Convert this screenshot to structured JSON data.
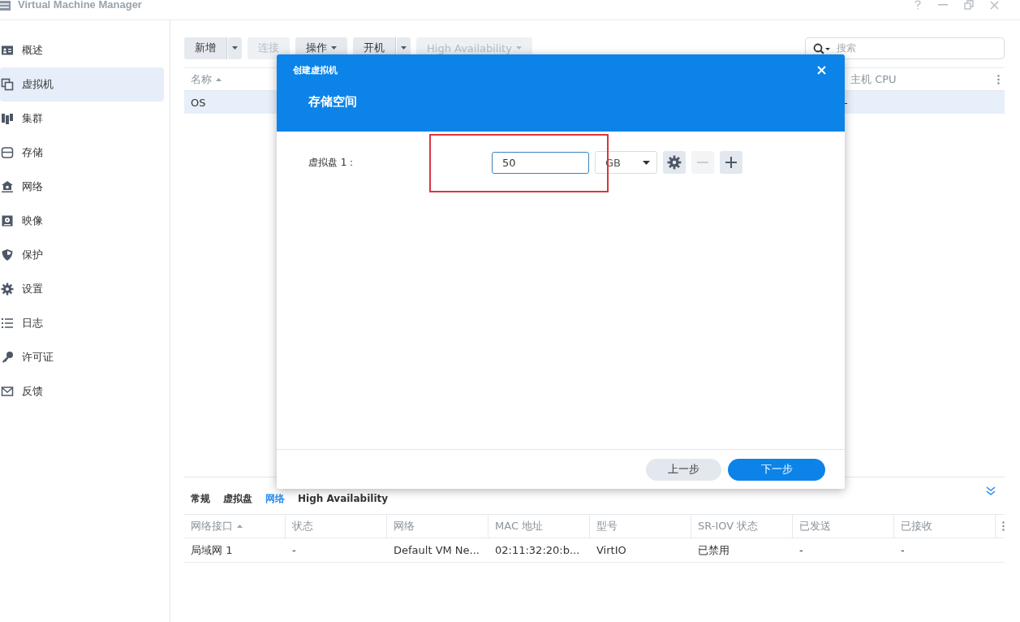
{
  "window": {
    "title": "Virtual Machine Manager"
  },
  "sidebar": {
    "items": [
      {
        "label": "概述",
        "selected": false
      },
      {
        "label": "虚拟机",
        "selected": true
      },
      {
        "label": "集群",
        "selected": false
      },
      {
        "label": "存储",
        "selected": false
      },
      {
        "label": "网络",
        "selected": false
      },
      {
        "label": "映像",
        "selected": false
      },
      {
        "label": "保护",
        "selected": false
      },
      {
        "label": "设置",
        "selected": false
      },
      {
        "label": "日志",
        "selected": false
      },
      {
        "label": "许可证",
        "selected": false
      },
      {
        "label": "反馈",
        "selected": false
      }
    ]
  },
  "toolbar": {
    "buttons": [
      {
        "label": "新增",
        "split": true,
        "menu": false,
        "disabled": false
      },
      {
        "label": "连接",
        "split": false,
        "menu": false,
        "disabled": true
      },
      {
        "label": "操作",
        "split": false,
        "menu": true,
        "disabled": false
      },
      {
        "label": "开机",
        "split": true,
        "menu": false,
        "disabled": false
      },
      {
        "label": "High Availability",
        "split": false,
        "menu": true,
        "disabled": true
      }
    ],
    "search": {
      "placeholder": "搜索"
    }
  },
  "vm_table": {
    "columns": [
      {
        "label": "名称",
        "sorted": true
      },
      {
        "label": "主机 CPU",
        "sorted": false
      }
    ],
    "rows": [
      {
        "cells": [
          "OS",
          "-"
        ],
        "selected": true
      }
    ]
  },
  "detail_panel": {
    "tabs": [
      {
        "label": "常规",
        "selected": false
      },
      {
        "label": "虚拟盘",
        "selected": false
      },
      {
        "label": "网络",
        "selected": true
      },
      {
        "label": "High Availability",
        "selected": false
      }
    ],
    "columns": [
      {
        "label": "网络接口",
        "sorted": true
      },
      {
        "label": "状态",
        "sorted": false
      },
      {
        "label": "网络",
        "sorted": false
      },
      {
        "label": "MAC 地址",
        "sorted": false
      },
      {
        "label": "型号",
        "sorted": false
      },
      {
        "label": "SR-IOV 状态",
        "sorted": false
      },
      {
        "label": "已发送",
        "sorted": false
      },
      {
        "label": "已接收",
        "sorted": false
      }
    ],
    "rows": [
      {
        "cells": [
          "局域网 1",
          "-",
          "Default VM Ne...",
          "02:11:32:20:b...",
          "VirtIO",
          "已禁用",
          "-",
          "-"
        ]
      }
    ]
  },
  "dialog": {
    "title": "创建虚拟机",
    "heading": "存储空间",
    "disks": [
      {
        "label": "虚拟盘 1：",
        "value": "50",
        "unit": "GB",
        "remove_disabled": true
      }
    ],
    "annotation": {
      "kind": "rectangle",
      "color": "#d9363e"
    },
    "buttons": [
      {
        "label": "上一步",
        "primary": false
      },
      {
        "label": "下一步",
        "primary": true
      }
    ]
  }
}
